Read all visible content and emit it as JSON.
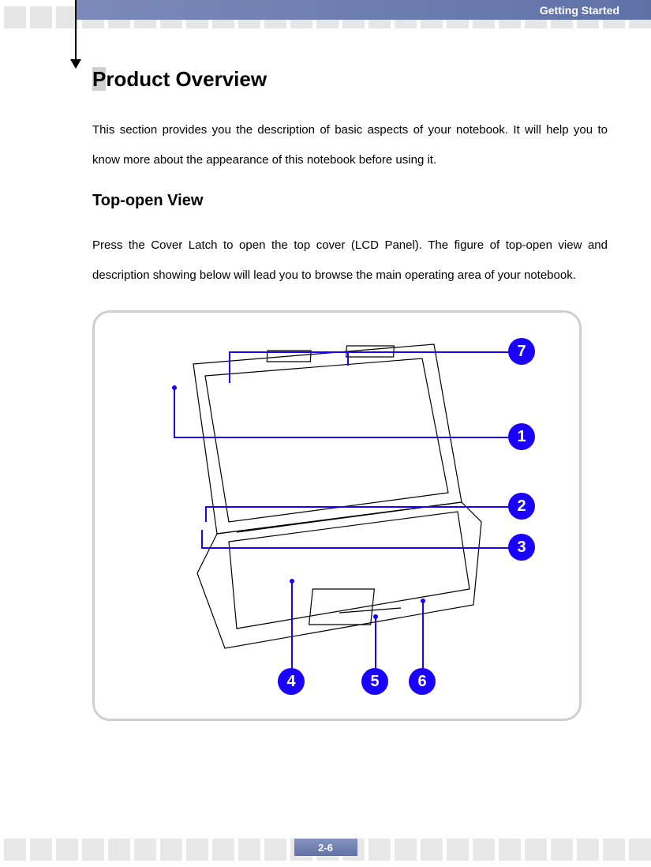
{
  "header": {
    "section": "Getting Started"
  },
  "page": {
    "number": "2-6"
  },
  "content": {
    "title": "Product Overview",
    "intro": "This section provides you the description of basic aspects of your notebook.    It will help you to know more about the appearance of this notebook before using it.",
    "subtitle": "Top-open View",
    "body": "Press the Cover Latch to open the top cover (LCD Panel). The figure of top-open view and description showing below will lead you to browse the main operating area of your notebook."
  },
  "callouts": {
    "c1": "1",
    "c2": "2",
    "c3": "3",
    "c4": "4",
    "c5": "5",
    "c6": "6",
    "c7": "7"
  }
}
